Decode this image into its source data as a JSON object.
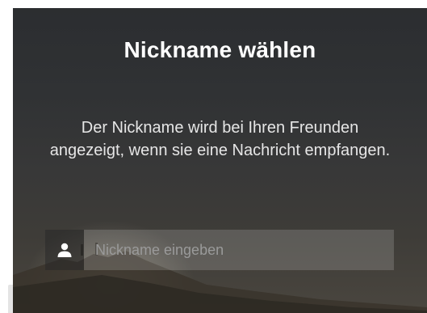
{
  "dialog": {
    "title": "Nickname wählen",
    "description": "Der Nickname wird bei Ihren Freunden angezeigt, wenn sie eine Nachricht empfangen."
  },
  "nickname_input": {
    "placeholder": "Nickname eingeben",
    "value": "",
    "icon": "user-icon"
  },
  "colors": {
    "text_primary": "#ffffff",
    "text_secondary": "#e6e6e6",
    "placeholder": "#9a9a9a"
  }
}
